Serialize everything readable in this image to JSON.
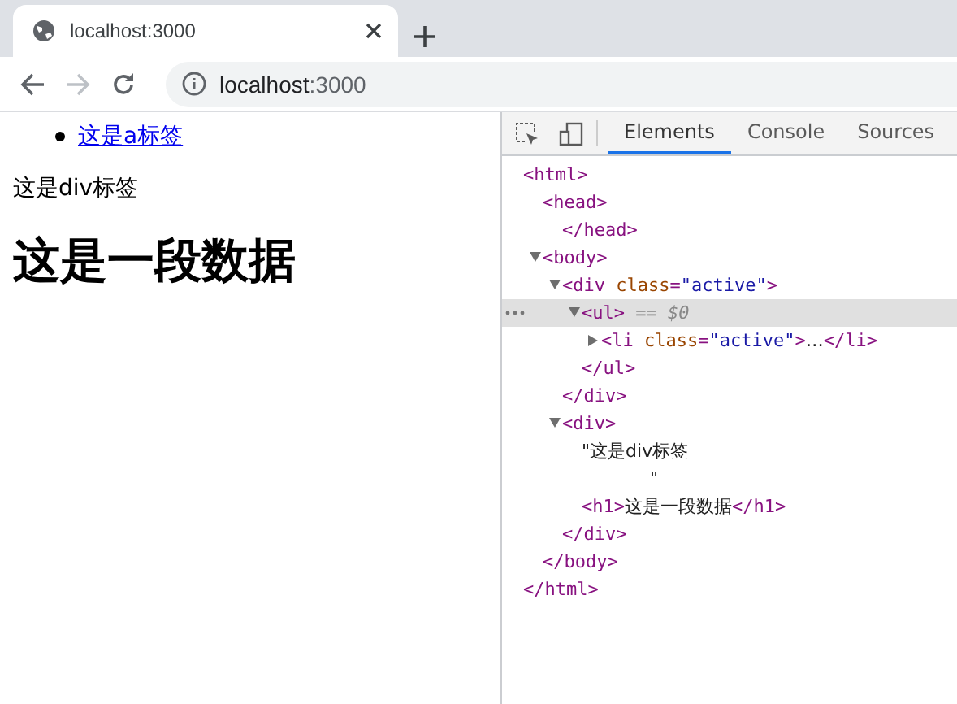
{
  "browser_tab": {
    "title": "localhost:3000",
    "selected": true
  },
  "address_bar": {
    "host": "localhost",
    "port": ":3000"
  },
  "page": {
    "list_items": [
      "这是a标签"
    ],
    "paragraph": "这是div标签",
    "heading": "这是一段数据"
  },
  "devtools": {
    "tabs": [
      {
        "label": "Elements",
        "selected": true
      },
      {
        "label": "Console",
        "selected": false
      },
      {
        "label": "Sources",
        "selected": false
      }
    ],
    "tree": [
      {
        "tokens": [
          {
            "kind": "tag",
            "text": "<html>"
          }
        ],
        "selected": false,
        "children": [
          {
            "tokens": [
              {
                "kind": "tag",
                "text": "<head>"
              }
            ],
            "selected": false,
            "children": [
              {
                "tokens": [
                  {
                    "kind": "tag",
                    "text": "</head>"
                  }
                ],
                "selected": false
              }
            ]
          },
          {
            "tokens": [
              {
                "kind": "tag",
                "text": "<body>"
              }
            ],
            "expanded": true,
            "selected": false,
            "children": [
              {
                "tokens": [
                  {
                    "kind": "tag",
                    "text": "<div"
                  },
                  {
                    "kind": "attr",
                    "text": " class"
                  },
                  {
                    "kind": "tag",
                    "text": "="
                  },
                  {
                    "kind": "value",
                    "text": "\"active\""
                  },
                  {
                    "kind": "tag",
                    "text": ">"
                  }
                ],
                "expanded": true,
                "selected": false,
                "children": [
                  {
                    "tokens": [
                      {
                        "kind": "tag",
                        "text": "<ul>"
                      },
                      {
                        "kind": "hint",
                        "text": " == $0"
                      }
                    ],
                    "expanded": true,
                    "selected": true,
                    "children": [
                      {
                        "tokens": [
                          {
                            "kind": "tag",
                            "text": "<li"
                          },
                          {
                            "kind": "attr",
                            "text": " class"
                          },
                          {
                            "kind": "tag",
                            "text": "="
                          },
                          {
                            "kind": "value",
                            "text": "\"active\""
                          },
                          {
                            "kind": "tag",
                            "text": ">"
                          },
                          {
                            "kind": "text",
                            "text": "…"
                          },
                          {
                            "kind": "tag",
                            "text": "</li>"
                          }
                        ],
                        "expanded": false,
                        "selected": false
                      }
                    ],
                    "close": [
                      {
                        "kind": "tag",
                        "text": "</ul>"
                      }
                    ]
                  }
                ],
                "close": [
                  {
                    "kind": "tag",
                    "text": "</div>"
                  }
                ]
              },
              {
                "tokens": [
                  {
                    "kind": "tag",
                    "text": "<div>"
                  }
                ],
                "expanded": true,
                "selected": false,
                "children": [
                  {
                    "tokens": [
                      {
                        "kind": "text",
                        "text": "\"这是div标签\n            \""
                      }
                    ],
                    "selected": false
                  },
                  {
                    "tokens": [
                      {
                        "kind": "tag",
                        "text": "<h1>"
                      },
                      {
                        "kind": "text",
                        "text": "这是一段数据"
                      },
                      {
                        "kind": "tag",
                        "text": "</h1>"
                      }
                    ],
                    "selected": false
                  }
                ],
                "close": [
                  {
                    "kind": "tag",
                    "text": "</div>"
                  }
                ]
              }
            ],
            "close": [
              {
                "kind": "tag",
                "text": "</body>"
              }
            ]
          }
        ],
        "close": [
          {
            "kind": "tag",
            "text": "</html>"
          }
        ]
      }
    ]
  }
}
